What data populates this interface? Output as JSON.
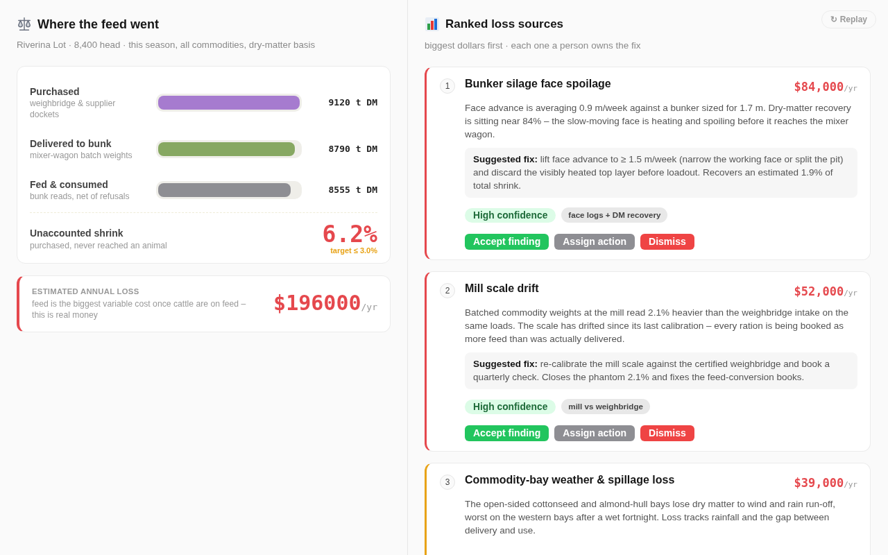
{
  "feed_panel": {
    "title": "Where the feed went",
    "subtitle": "Riverina Lot · 8,400 head · this season, all commodities, dry-matter basis",
    "flows": [
      {
        "label": "Purchased",
        "note": "weighbridge & supplier dockets",
        "level": 1,
        "color": "#a67bcf",
        "value": "9120 t DM"
      },
      {
        "label": "Delivered to bunk",
        "note": "mixer-wagon batch weights",
        "level": 0.964,
        "color": "#87a862",
        "value": "8790 t DM"
      },
      {
        "label": "Fed & consumed",
        "note": "bunk reads, net of refusals",
        "level": 0.938,
        "color": "#8e8e93",
        "value": "8555 t DM"
      }
    ],
    "shrink": {
      "label": "Unaccounted shrink",
      "note": "purchased, never reached an animal",
      "value": "6.2%",
      "target": "target ≤ 3.0%"
    },
    "loss": {
      "label": "ESTIMATED ANNUAL LOSS",
      "note": "feed is the biggest variable cost once cattle are on feed – this is real money",
      "amount": "$196000",
      "unit": "/yr"
    }
  },
  "loss_panel": {
    "title": "Ranked loss sources",
    "subtitle": "biggest dollars first · each one a person owns the fix",
    "replay_button": "↻ Replay",
    "sources": [
      {
        "rank": "1",
        "color": "#e5484d",
        "title": "Bunker silage face spoilage",
        "amount": "$84,000",
        "unit": "/yr",
        "body": "Face advance is averaging 0.9 m/week against a bunker sized for 1.7 m. Dry-matter recovery is sitting near 84% – the slow-moving face is heating and spoiling before it reaches the mixer wagon.",
        "fix": "**Suggested fix:** lift face advance to ≥ 1.5 m/week (narrow the working face or split the pit) and discard the visibly heated top layer before loadout. Recovers an estimated 1.9% of total shrink.",
        "confidence": "High confidence",
        "evidence": "face logs + DM recovery",
        "actions": [
          {
            "kind": "accept",
            "label": "Accept finding"
          },
          {
            "kind": "assign",
            "label": "Assign action"
          },
          {
            "kind": "dismiss",
            "label": "Dismiss"
          }
        ]
      },
      {
        "rank": "2",
        "color": "#e5484d",
        "title": "Mill scale drift",
        "amount": "$52,000",
        "unit": "/yr",
        "body": "Batched commodity weights at the mill read 2.1% heavier than the weighbridge intake on the same loads. The scale has drifted since its last calibration – every ration is being booked as more feed than was actually delivered.",
        "fix": "**Suggested fix:** re-calibrate the mill scale against the certified weighbridge and book a quarterly check. Closes the phantom 2.1% and fixes the feed-conversion books.",
        "confidence": "High confidence",
        "evidence": "mill vs weighbridge",
        "actions": [
          {
            "kind": "accept",
            "label": "Accept finding"
          },
          {
            "kind": "assign",
            "label": "Assign action"
          },
          {
            "kind": "dismiss",
            "label": "Dismiss"
          }
        ]
      },
      {
        "rank": "3",
        "color": "#e8a317",
        "title": "Commodity-bay weather & spillage loss",
        "amount": "$39,000",
        "unit": "/yr",
        "body": "The open-sided cottonseed and almond-hull bays lose dry matter to wind and rain run-off, worst on the western bays after a wet fortnight. Loss tracks rainfall and the gap between delivery and use."
      }
    ]
  }
}
